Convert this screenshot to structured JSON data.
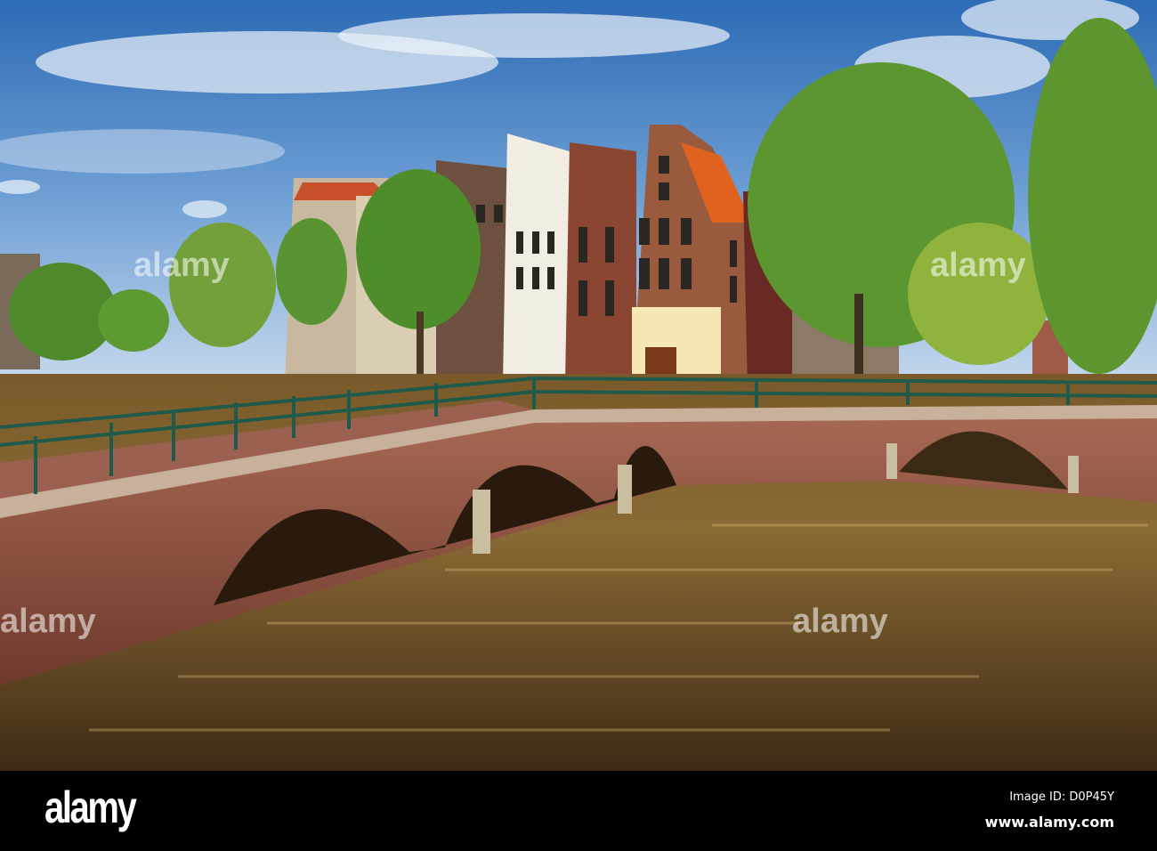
{
  "scene": {
    "description_colors": {
      "sky": "#3f7fc4",
      "water": "#6b4a1f",
      "brick": "#8e4d3c",
      "tree": "#4f8a2a"
    }
  },
  "watermark": {
    "text": "alamy"
  },
  "footer": {
    "logo": "alamy",
    "image_id": "Image ID: D0P45Y",
    "website": "www.alamy.com"
  }
}
